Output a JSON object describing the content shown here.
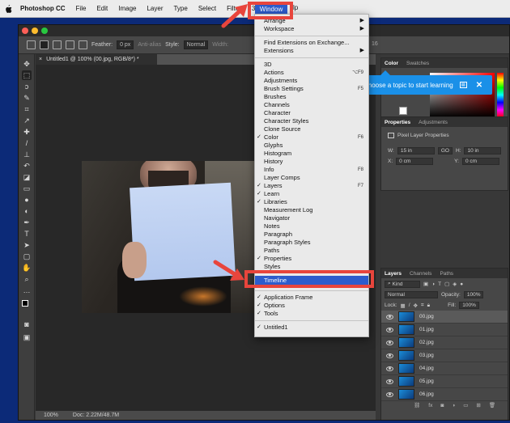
{
  "menubar": {
    "app": "Photoshop CC",
    "items": [
      "File",
      "Edit",
      "Image",
      "Layer",
      "Type",
      "Select",
      "Filter",
      "3D",
      "Vi"
    ],
    "selected": "Window",
    "after": "lp"
  },
  "options_bar": {
    "feather_label": "Feather:",
    "feather_value": "0 px",
    "antialias": "Anti-alias",
    "style_label": "Style:",
    "style_value": "Normal",
    "width_label": "Width:",
    "right_text": "16"
  },
  "document": {
    "tab_label": "Untitled1 @ 100% (00.jpg, RGB/8*) *",
    "zoom": "100%",
    "doc_size": "Doc: 2.22M/48.7M"
  },
  "color_panel": {
    "tabs": [
      "Color",
      "Swatches"
    ]
  },
  "tooltip": {
    "text": "Choose a topic to start learning"
  },
  "properties_panel": {
    "tabs": [
      "Properties",
      "Adjustments"
    ],
    "title": "Pixel Layer Properties",
    "w_label": "W:",
    "w_value": "15 in",
    "go_label": "GO",
    "h_label": "H:",
    "h_value": "10 in",
    "x_label": "X:",
    "x_value": "0 cm",
    "y_label": "Y:",
    "y_value": "0 cm"
  },
  "layers_panel": {
    "tabs": [
      "Layers",
      "Channels",
      "Paths"
    ],
    "kind": "Kind",
    "blend": "Normal",
    "opacity_label": "Opacity:",
    "opacity_value": "100%",
    "lock_label": "Lock:",
    "fill_label": "Fill:",
    "fill_value": "100%",
    "layers": [
      "00.jpg",
      "01.jpg",
      "02.jpg",
      "03.jpg",
      "04.jpg",
      "05.jpg",
      "06.jpg"
    ]
  },
  "window_menu": {
    "top": [
      {
        "label": "Arrange",
        "sub": true
      },
      {
        "label": "Workspace",
        "sub": true
      }
    ],
    "mid": [
      {
        "label": "Find Extensions on Exchange..."
      },
      {
        "label": "Extensions",
        "sub": true
      }
    ],
    "panels": [
      {
        "label": "3D"
      },
      {
        "label": "Actions",
        "shortcut": "⌥F9"
      },
      {
        "label": "Adjustments"
      },
      {
        "label": "Brush Settings",
        "shortcut": "F5"
      },
      {
        "label": "Brushes"
      },
      {
        "label": "Channels"
      },
      {
        "label": "Character"
      },
      {
        "label": "Character Styles"
      },
      {
        "label": "Clone Source"
      },
      {
        "label": "Color",
        "shortcut": "F6",
        "checked": true
      },
      {
        "label": "Glyphs"
      },
      {
        "label": "Histogram"
      },
      {
        "label": "History"
      },
      {
        "label": "Info",
        "shortcut": "F8"
      },
      {
        "label": "Layer Comps"
      },
      {
        "label": "Layers",
        "shortcut": "F7",
        "checked": true
      },
      {
        "label": "Learn",
        "checked": true
      },
      {
        "label": "Libraries",
        "checked": true
      },
      {
        "label": "Measurement Log"
      },
      {
        "label": "Navigator"
      },
      {
        "label": "Notes"
      },
      {
        "label": "Paragraph"
      },
      {
        "label": "Paragraph Styles"
      },
      {
        "label": "Paths"
      },
      {
        "label": "Properties",
        "checked": true
      },
      {
        "label": "Styles"
      }
    ],
    "highlighted": "Timeline",
    "bottom": [
      {
        "label": "Application Frame",
        "checked": true
      },
      {
        "label": "Options",
        "checked": true
      },
      {
        "label": "Tools",
        "checked": true
      }
    ],
    "docs": [
      {
        "label": "Untitled1",
        "checked": true
      }
    ]
  },
  "colors": {
    "annotation": "#e8453c",
    "menu_highlight": "#2d5ccc",
    "tooltip": "#1a90e8",
    "desktop": "#0c2a78"
  }
}
